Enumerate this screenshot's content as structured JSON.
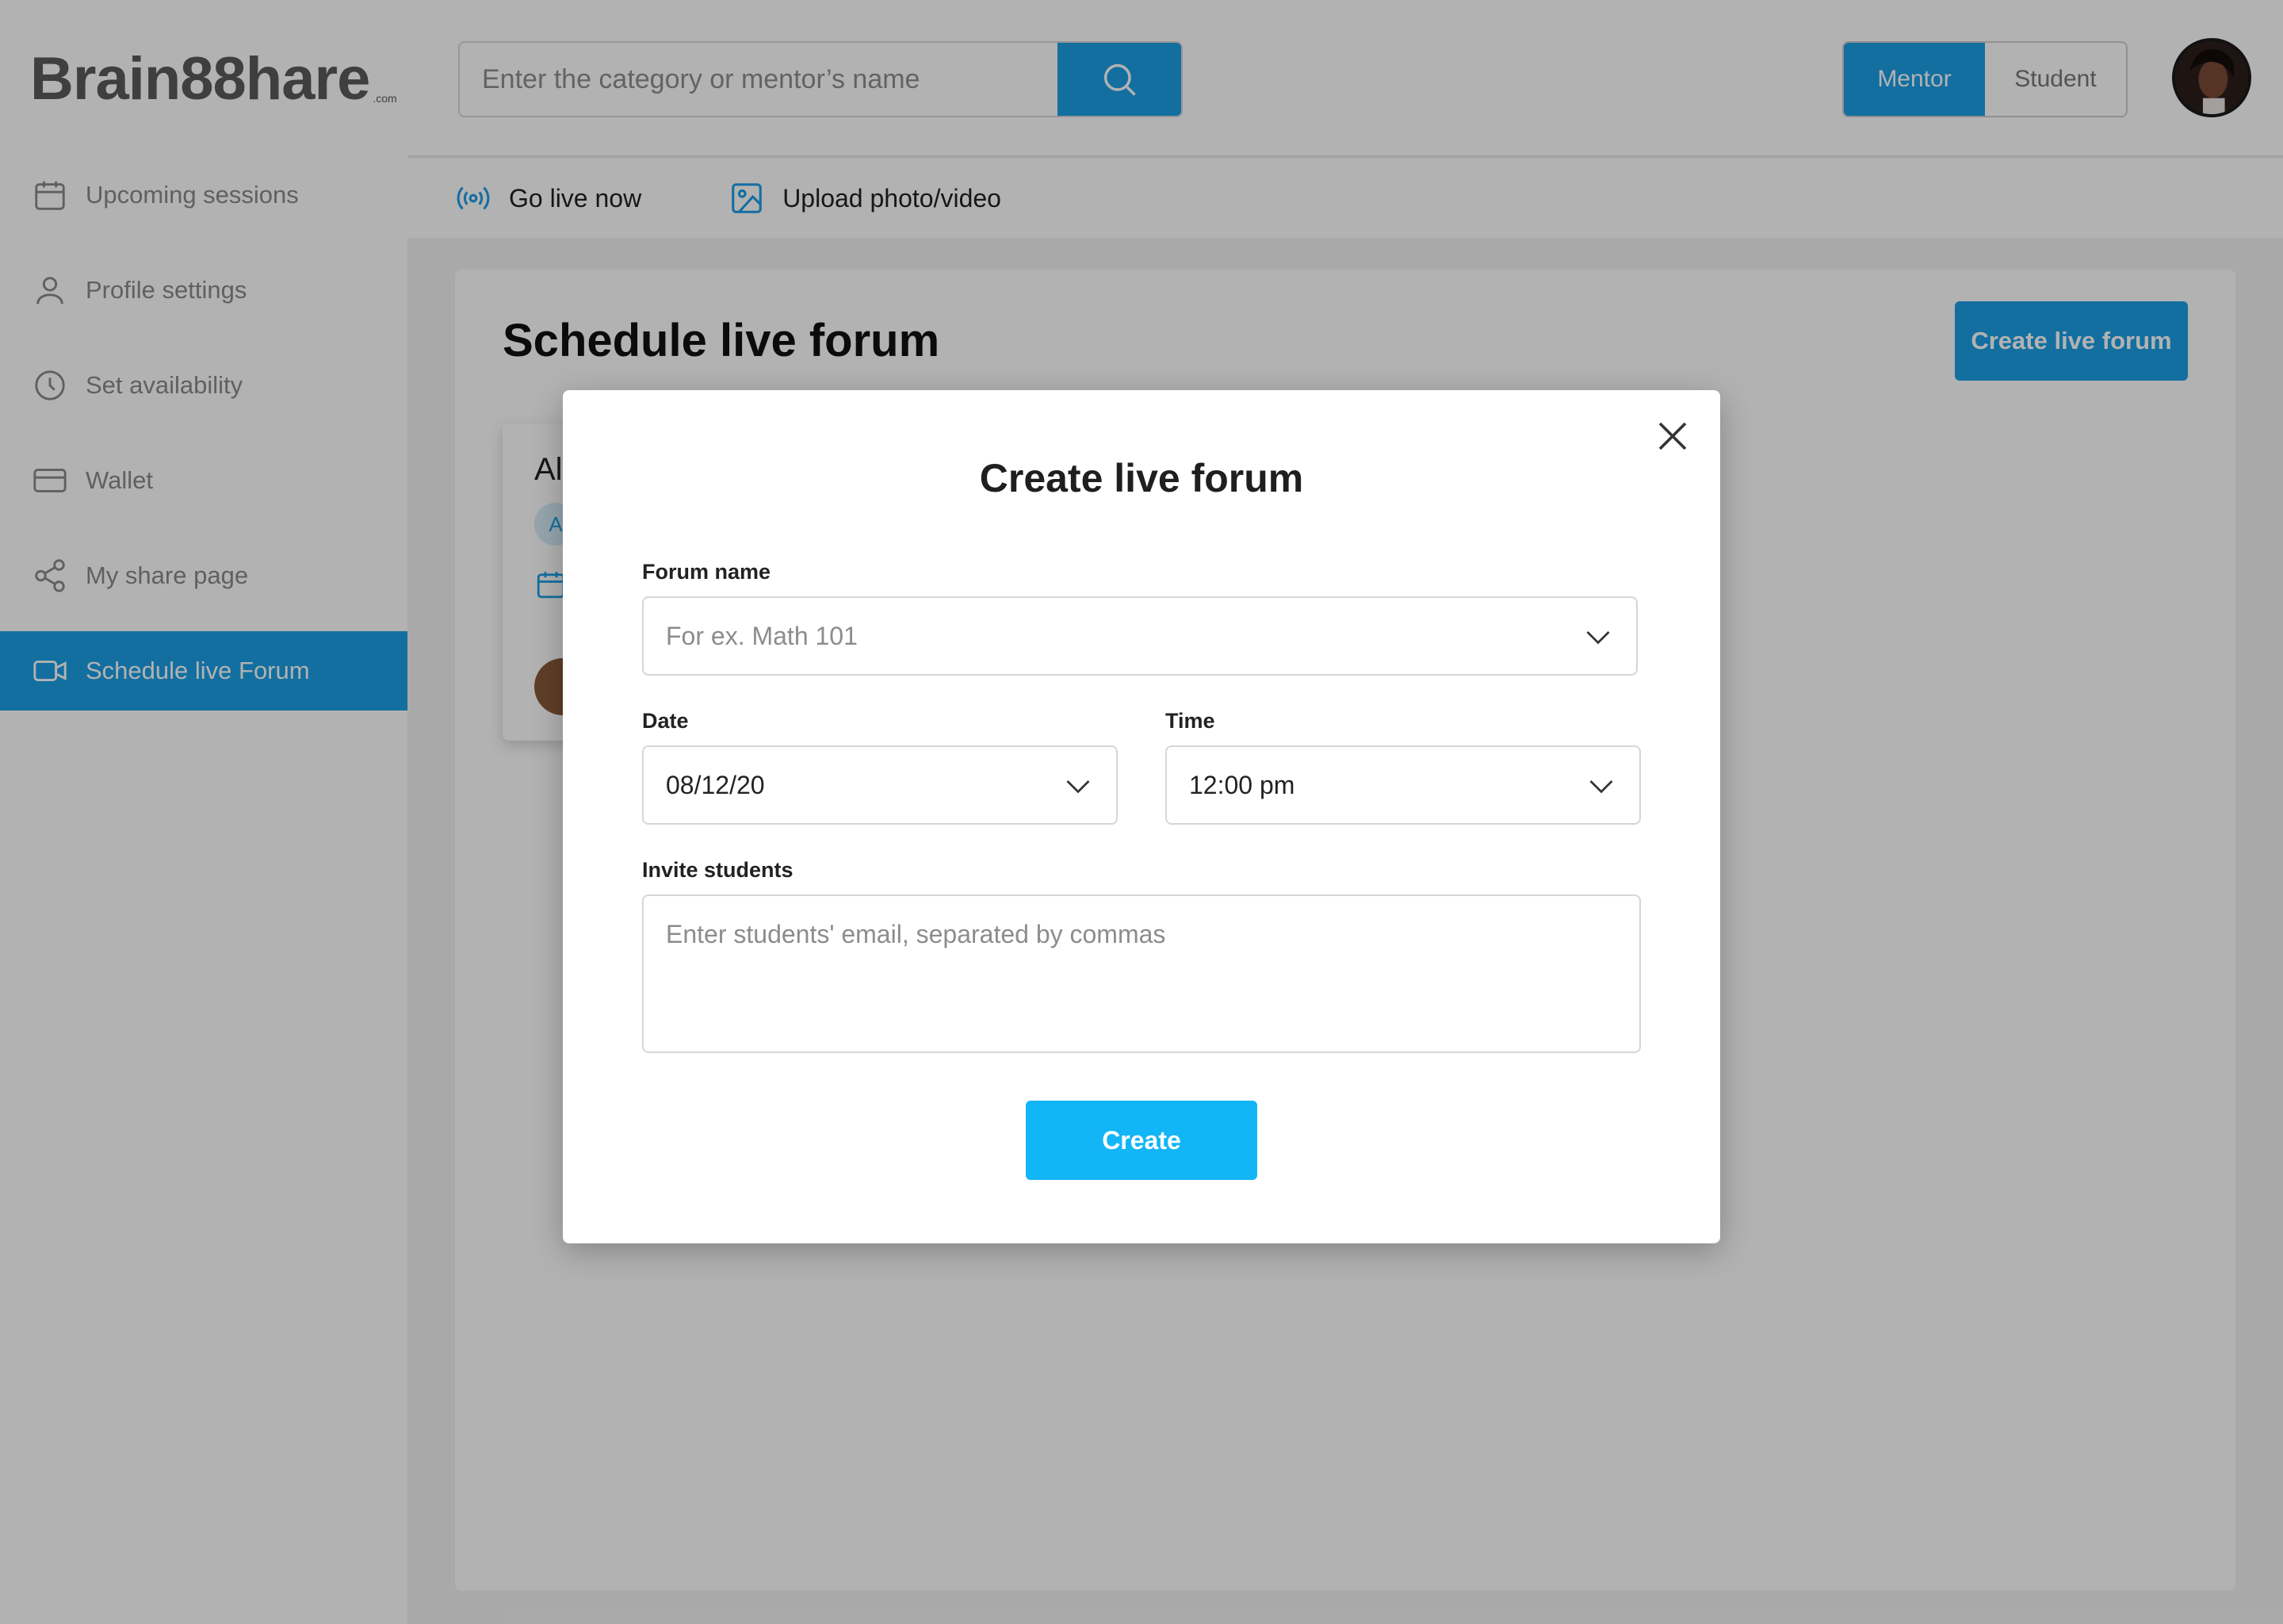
{
  "app": {
    "logo_text": "Brain88hare",
    "logo_suffix": ".com"
  },
  "sidebar": {
    "items": [
      {
        "label": "Upcoming sessions",
        "icon": "calendar-icon",
        "active": false
      },
      {
        "label": "Profile settings",
        "icon": "user-icon",
        "active": false
      },
      {
        "label": "Set availability",
        "icon": "clock-icon",
        "active": false
      },
      {
        "label": "Wallet",
        "icon": "wallet-icon",
        "active": false
      },
      {
        "label": "My share page",
        "icon": "share-icon",
        "active": false
      },
      {
        "label": "Schedule live Forum",
        "icon": "video-icon",
        "active": true
      }
    ]
  },
  "header": {
    "search_placeholder": "Enter the category or mentor’s name",
    "role_toggle": {
      "mentor": "Mentor",
      "student": "Student",
      "selected": "Mentor"
    }
  },
  "subbar": {
    "go_live": "Go live now",
    "upload": "Upload photo/video"
  },
  "main": {
    "title": "Schedule live forum",
    "create_button": "Create live forum",
    "card_title_partial": "Al",
    "card_chip": "A"
  },
  "modal": {
    "title": "Create live forum",
    "forum_name_label": "Forum name",
    "forum_name_placeholder": "For ex. Math 101",
    "date_label": "Date",
    "date_value": "08/12/20",
    "time_label": "Time",
    "time_value": "12:00 pm",
    "invite_label": "Invite students",
    "invite_placeholder": "Enter students' email, separated by commas",
    "create_button": "Create"
  },
  "colors": {
    "accent": "#1aa0e6",
    "create_button": "#12b5f5",
    "overlay": "rgba(0,0,0,0.30)"
  }
}
